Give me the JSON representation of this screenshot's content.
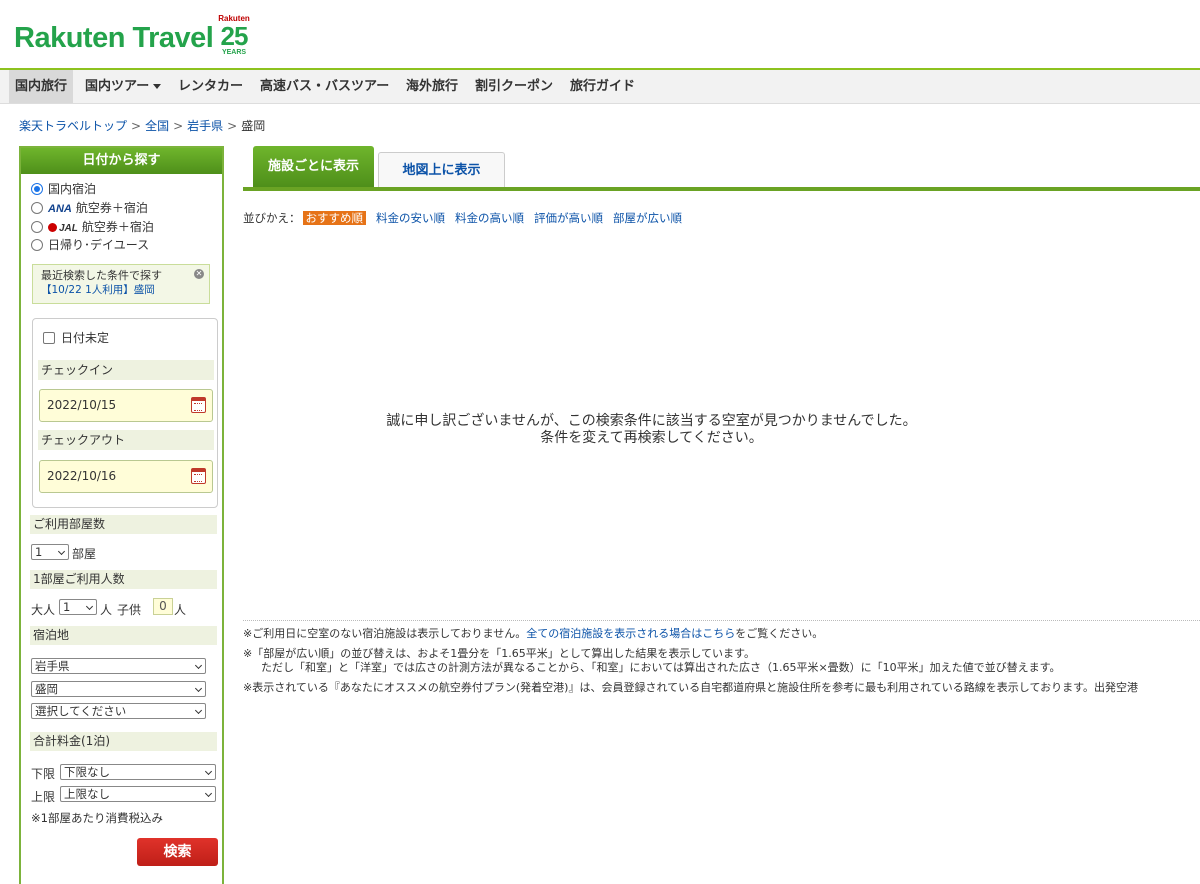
{
  "header": {
    "logo": "Rakuten Travel",
    "anniversary": {
      "brand": "Rakuten",
      "number": "25",
      "word": "YEARS"
    }
  },
  "nav": {
    "items": [
      {
        "label": "国内旅行",
        "active": true,
        "dropdown": false
      },
      {
        "label": "国内ツアー",
        "active": false,
        "dropdown": true
      },
      {
        "label": "レンタカー",
        "active": false,
        "dropdown": false
      },
      {
        "label": "高速バス・バスツアー",
        "active": false,
        "dropdown": false
      },
      {
        "label": "海外旅行",
        "active": false,
        "dropdown": false
      },
      {
        "label": "割引クーポン",
        "active": false,
        "dropdown": false
      },
      {
        "label": "旅行ガイド",
        "active": false,
        "dropdown": false
      }
    ]
  },
  "breadcrumb": [
    "楽天トラベルトップ",
    "全国",
    "岩手県",
    "盛岡"
  ],
  "sidebar": {
    "title": "日付から探す",
    "travel_types": [
      {
        "label": "国内宿泊",
        "selected": true
      },
      {
        "prefix": "ANA",
        "label": "航空券＋宿泊",
        "selected": false
      },
      {
        "prefix": "JAL",
        "label": "航空券＋宿泊",
        "selected": false
      },
      {
        "label": "日帰り･デイユース",
        "selected": false
      }
    ],
    "recent": {
      "title": "最近検索した条件で探す",
      "link": "【10/22 1人利用】盛岡"
    },
    "date_undecided": "日付未定",
    "checkin_label": "チェックイン",
    "checkin_value": "2022/10/15",
    "checkout_label": "チェックアウト",
    "checkout_value": "2022/10/16",
    "rooms_label": "ご利用部屋数",
    "rooms_value": "1",
    "rooms_unit": "部屋",
    "guests_label": "1部屋ご利用人数",
    "adult_label": "大人",
    "adult_value": "1",
    "adult_unit": "人",
    "child_label": "子供",
    "child_value": "0",
    "child_unit": "人",
    "area_label": "宿泊地",
    "area_pref": "岩手県",
    "area_city": "盛岡",
    "area_detail": "選択してください",
    "price_label": "合計料金(1泊)",
    "min_label": "下限",
    "min_value": "下限なし",
    "max_label": "上限",
    "max_value": "上限なし",
    "tax_note": "※1部屋あたり消費税込み",
    "search_button": "検索"
  },
  "tabs": {
    "list": "施設ごとに表示",
    "map": "地図上に表示"
  },
  "sort": {
    "label": "並びかえ：",
    "current": "おすすめ順",
    "options": [
      "料金の安い順",
      "料金の高い順",
      "評価が高い順",
      "部屋が広い順"
    ]
  },
  "no_result": {
    "line1": "誠に申し訳ございませんが、この検索条件に該当する空室が見つかりませんでした。",
    "line2": "条件を変えて再検索してください。"
  },
  "notes": {
    "n1_pre": "※ご利用日に空室のない宿泊施設は表示しておりません。",
    "n1_link": "全ての宿泊施設を表示される場合はこちら",
    "n1_post": "をご覧ください。",
    "n2_line1": "※「部屋が広い順」の並び替えは、およそ1畳分を「1.65平米」として算出した結果を表示しています。",
    "n2_line2": "ただし「和室」と「洋室」では広さの計測方法が異なることから、「和室」においては算出された広さ（1.65平米×畳数）に「10平米」加えた値で並び替えます。",
    "n3": "※表示されている『あなたにオススメの航空券付プラン(発着空港)』は、会員登録されている自宅都道府県と施設住所を参考に最も利用されている路線を表示しております。出発空港"
  }
}
